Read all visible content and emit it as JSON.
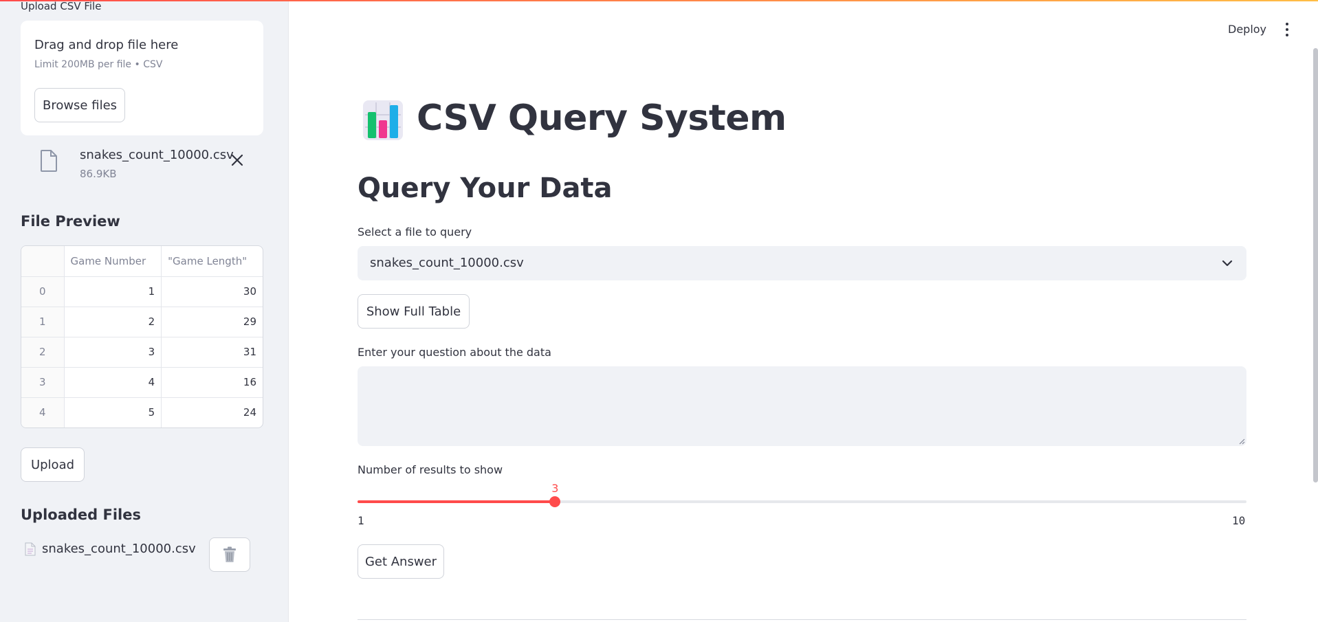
{
  "sidebar": {
    "upload_label": "Upload CSV File",
    "dropzone": {
      "title": "Drag and drop file here",
      "subtitle": "Limit 200MB per file • CSV",
      "browse_label": "Browse files"
    },
    "uploaded_file": {
      "name": "snakes_count_10000.csv",
      "size": "86.9KB"
    },
    "preview": {
      "heading": "File Preview",
      "columns": [
        "",
        "Game Number",
        "\"Game Length\""
      ],
      "rows": [
        [
          "0",
          "1",
          "30"
        ],
        [
          "1",
          "2",
          "29"
        ],
        [
          "2",
          "3",
          "31"
        ],
        [
          "3",
          "4",
          "16"
        ],
        [
          "4",
          "5",
          "24"
        ]
      ]
    },
    "upload_button": "Upload",
    "uploaded_files_heading": "Uploaded Files",
    "uploaded_files": [
      {
        "name": "snakes_count_10000.csv"
      }
    ]
  },
  "header": {
    "deploy_label": "Deploy"
  },
  "main": {
    "title": "CSV Query System",
    "subtitle": "Query Your Data",
    "select_label": "Select a file to query",
    "select_value": "snakes_count_10000.csv",
    "show_table_label": "Show Full Table",
    "question_label": "Enter your question about the data",
    "question_value": "",
    "slider": {
      "label": "Number of results to show",
      "min": 1,
      "max": 10,
      "value": 3,
      "min_label": "1",
      "max_label": "10",
      "value_label": "3"
    },
    "get_answer_label": "Get Answer"
  },
  "colors": {
    "accent": "#ff4b4b",
    "sidebar_bg": "#f0f2f6",
    "text": "#31333f",
    "muted": "#808495"
  }
}
